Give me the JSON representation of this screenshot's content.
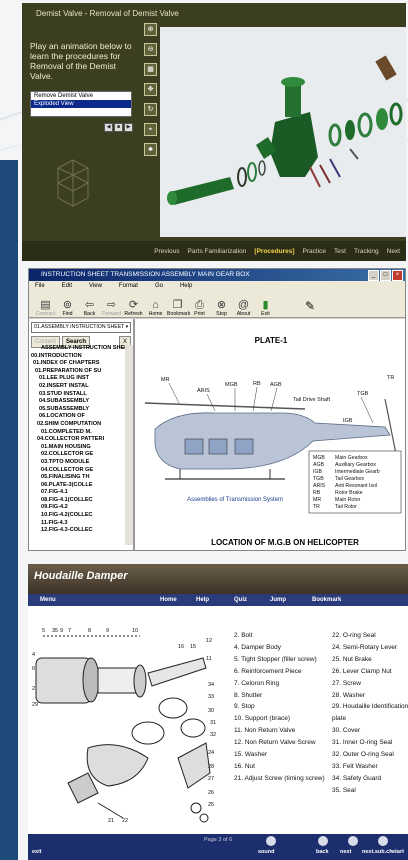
{
  "panel1": {
    "app_name": "Demist Valve",
    "title_suffix": " - Removal of Demist Valve",
    "intro": "Play an animation below to learn the procedures for Removal of the Demist Valve.",
    "list_items": [
      "Remove Demist Valve",
      "Exploded View"
    ],
    "selected_item": "Exploded View",
    "nav": [
      "Previous",
      "Parts Familiarization",
      "[Procedures]",
      "Practice",
      "Test",
      "Tracking",
      "Next"
    ]
  },
  "panel2": {
    "title": "INSTRUCTION SHEET TRANSMISSION ASSEMBLY MAIN GEAR BOX",
    "menu": [
      "File",
      "Edit",
      "View",
      "Format",
      "Go",
      "Help"
    ],
    "toolbar": [
      {
        "label": "Contract",
        "icon": "contract-icon",
        "disabled": true
      },
      {
        "label": "Find",
        "icon": "binoculars-icon",
        "disabled": false
      },
      {
        "label": "Back",
        "icon": "back-arrow-icon",
        "disabled": false
      },
      {
        "label": "Forward",
        "icon": "forward-arrow-icon",
        "disabled": true
      },
      {
        "label": "Refresh",
        "icon": "refresh-icon",
        "disabled": false
      },
      {
        "label": "Home",
        "icon": "home-icon",
        "disabled": false
      },
      {
        "label": "Bookmark",
        "icon": "bookmark-icon",
        "disabled": false
      },
      {
        "label": "Print",
        "icon": "printer-icon",
        "disabled": false
      },
      {
        "label": "Stop",
        "icon": "stop-icon",
        "disabled": false
      },
      {
        "label": "About",
        "icon": "about-icon",
        "disabled": false
      },
      {
        "label": "Exit",
        "icon": "exit-icon",
        "disabled": false
      }
    ],
    "doc_select": "01.ASSEMBLY INSTRUCTION SHEET",
    "buttons": {
      "content": "Content",
      "search": "Search",
      "close": "X"
    },
    "tree": [
      "ASSEMBLY INSTRUCTION SHEET(",
      "00.INTRODUCTION",
      "01.INDEX OF CHAPTERS",
      "01.PREPARATION OF SU",
      "01.LEE PLUG INST",
      "02.INSERT INSTAL",
      "03.STUD INSTALL",
      "04.SUBASSEMBLY",
      "05.SUBASSEMBLY",
      "06.LOCATION OF",
      "02.SHIM COMPUTATION",
      "01.COMPLETED M.",
      "04.COLLECTOR PATTERI",
      "01.MAIN HOUSING",
      "02.COLLECTOR GE",
      "03.TPTO MODULE",
      "04.COLLECTOR GE",
      "05.FINALISING TH",
      "06.PLATE-3(COLLE",
      "07.FIG-4.1",
      "08.FIG-4.1(COLLEC",
      "09.FIG-4.2",
      "10.FIG-4.2(COLLEC",
      "11.FIG-4.3",
      "12.FIG-4.3-COLLEC"
    ],
    "plate_title": "PLATE-1",
    "caption": "Assemblies of Transmission System",
    "footer": "LOCATION OF M.G.B ON HELICOPTER",
    "callouts": [
      "MR",
      "ARIS",
      "MGB",
      "RB",
      "AGB",
      "TGB",
      "Tail Drive Shaft",
      "IGB",
      "TR"
    ],
    "legend": [
      [
        "MGB",
        "Main Gearbox"
      ],
      [
        "AGB",
        "Auxiliary Gearbox"
      ],
      [
        "IGB",
        "Intermediate Gearb"
      ],
      [
        "TGB",
        "Tail Gearbox"
      ],
      [
        "ARIS",
        "Anti Resonant Isol"
      ],
      [
        "RB",
        "Rotor Brake"
      ],
      [
        "MR",
        "Main Rotor"
      ],
      [
        "TR",
        "Tail Rotor"
      ]
    ]
  },
  "panel3": {
    "title": "Houdaille Damper",
    "menu": [
      "Menu",
      "Home",
      "Help",
      "Quiz",
      "Jump",
      "Bookmark"
    ],
    "parts_left": [
      "2. Bolt",
      "4. Damper Body",
      "5. Tight Stopper (filler screw)",
      "6. Reinforcement Piece",
      "7. Celoron Ring",
      "8. Shutter",
      "9. Stop",
      "10. Support (brace)",
      "11. Non Return Valve",
      "12. Non Return Valve Screw",
      "15. Washer",
      "16. Nut",
      "21. Adjust Screw (timing screw)"
    ],
    "parts_right": [
      "22. O-ring Seal",
      "24. Semi-Rotary Lever",
      "25. Nut Brake",
      "26. Lever Clamp Nut",
      "27. Screw",
      "28. Washer",
      "29. Houdaille Identification",
      "plate",
      "30. Cover",
      "31. Inner O-ring Seal",
      "32. Outer O-ring Seal",
      "33. Felt Washer",
      "34. Safety Guard",
      "35. Seal"
    ],
    "diagram_labels": [
      "5",
      "35",
      "9",
      "7",
      "8",
      "9",
      "10",
      "4",
      "6",
      "2",
      "29",
      "16",
      "15",
      "12",
      "11",
      "34",
      "33",
      "30",
      "31",
      "32",
      "21",
      "22",
      "24",
      "28",
      "27",
      "26",
      "25"
    ],
    "page": "Page 3 of 6",
    "controls": [
      "sound",
      "back",
      "next",
      "next.sub.ch",
      "start"
    ],
    "exit": "exit"
  }
}
